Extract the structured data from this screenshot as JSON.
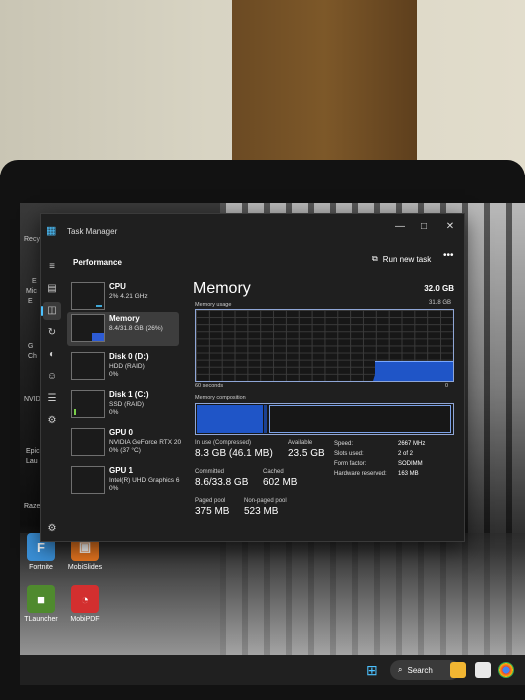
{
  "desktop": {
    "icons": [
      {
        "label": "Fortnite",
        "color": "#3a8fd6",
        "glyph": "F"
      },
      {
        "label": "MobiSlides",
        "color": "#e3741f",
        "glyph": "▣"
      },
      {
        "label": "TLauncher",
        "color": "#4f8a2e",
        "glyph": "■"
      },
      {
        "label": "MobiPDF",
        "color": "#d32f2f",
        "glyph": "◔"
      }
    ],
    "partial_labels": [
      "Recy",
      "E",
      "Mic",
      "E",
      "G",
      "Ch",
      "NVID",
      "Epic",
      "Lau",
      "Razer"
    ]
  },
  "taskbar": {
    "start_icon": "windows-start-icon",
    "search_label": "Search"
  },
  "task_manager": {
    "window_title": "Task Manager",
    "window_controls": {
      "minimize": "—",
      "maximize": "□",
      "close": "✕"
    },
    "page_heading": "Performance",
    "run_new_task_label": "Run new task",
    "more_label": "•••",
    "devices": [
      {
        "name": "CPU",
        "sub1": "2% 4.21 GHz",
        "sub2": ""
      },
      {
        "name": "Memory",
        "sub1": "8.4/31.8 GB (26%)",
        "sub2": ""
      },
      {
        "name": "Disk 0 (D:)",
        "sub1": "HDD (RAID)",
        "sub2": "0%"
      },
      {
        "name": "Disk 1 (C:)",
        "sub1": "SSD (RAID)",
        "sub2": "0%"
      },
      {
        "name": "GPU 0",
        "sub1": "NVIDIA GeForce RTX 20",
        "sub2": "0% (37 °C)"
      },
      {
        "name": "GPU 1",
        "sub1": "Intel(R) UHD Graphics 6",
        "sub2": "0%"
      }
    ],
    "memory": {
      "title": "Memory",
      "total": "32.0 GB",
      "usage_label": "Memory usage",
      "usage_max": "31.8 GB",
      "time_label": "60 seconds",
      "time_zero": "0",
      "composition_label": "Memory composition",
      "in_use_label": "In use (Compressed)",
      "in_use_value": "8.3 GB (46.1 MB)",
      "available_label": "Available",
      "available_value": "23.5 GB",
      "committed_label": "Committed",
      "committed_value": "8.6/33.8 GB",
      "cached_label": "Cached",
      "cached_value": "602 MB",
      "paged_label": "Paged pool",
      "paged_value": "375 MB",
      "nonpaged_label": "Non-paged pool",
      "nonpaged_value": "523 MB",
      "speed_label": "Speed:",
      "speed_value": "2667 MHz",
      "slots_label": "Slots used:",
      "slots_value": "2 of 2",
      "form_label": "Form factor:",
      "form_value": "SODIMM",
      "hwres_label": "Hardware reserved:",
      "hwres_value": "163 MB"
    }
  },
  "colors": {
    "accent": "#4cc2ff",
    "memory_blue": "#1f55c7",
    "window_bg": "#1f1f1f"
  }
}
